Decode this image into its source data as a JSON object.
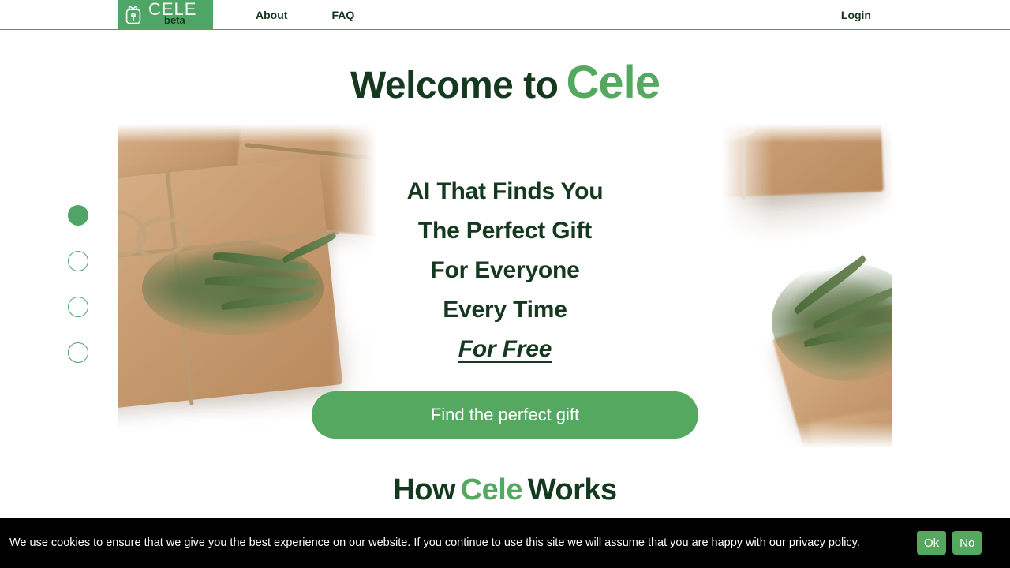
{
  "navbar": {
    "brand": {
      "icon": "gift-box-icon",
      "name": "CELE",
      "badge": "beta"
    },
    "links": [
      {
        "label": "About"
      },
      {
        "label": "FAQ"
      }
    ],
    "login_label": "Login"
  },
  "hero": {
    "title_prefix": "Welcome to",
    "title_brand": "Cele",
    "carousel": {
      "dots": [
        {
          "active": true
        },
        {
          "active": false
        },
        {
          "active": false
        },
        {
          "active": false
        }
      ]
    },
    "lines": [
      "AI That Finds You",
      "The Perfect Gift",
      "For Everyone",
      "Every Time"
    ],
    "free_line": "For Free",
    "cta_label": "Find the perfect gift"
  },
  "how_section": {
    "title_prefix": "How",
    "title_brand": "Cele",
    "title_suffix": "Works"
  },
  "cookie_banner": {
    "text_before_link": "We use cookies to ensure that we give you the best experience on our website. If you continue to use this site we will assume that you are happy with our ",
    "link_label": "privacy policy",
    "text_after_link": ".",
    "accept_label": "Ok",
    "decline_label": "No"
  },
  "colors": {
    "brand_green": "#55a85f",
    "logo_green": "#4fa565",
    "dark_green": "#14391f",
    "banner_bg": "#000000",
    "page_bg": "#ffffff"
  }
}
